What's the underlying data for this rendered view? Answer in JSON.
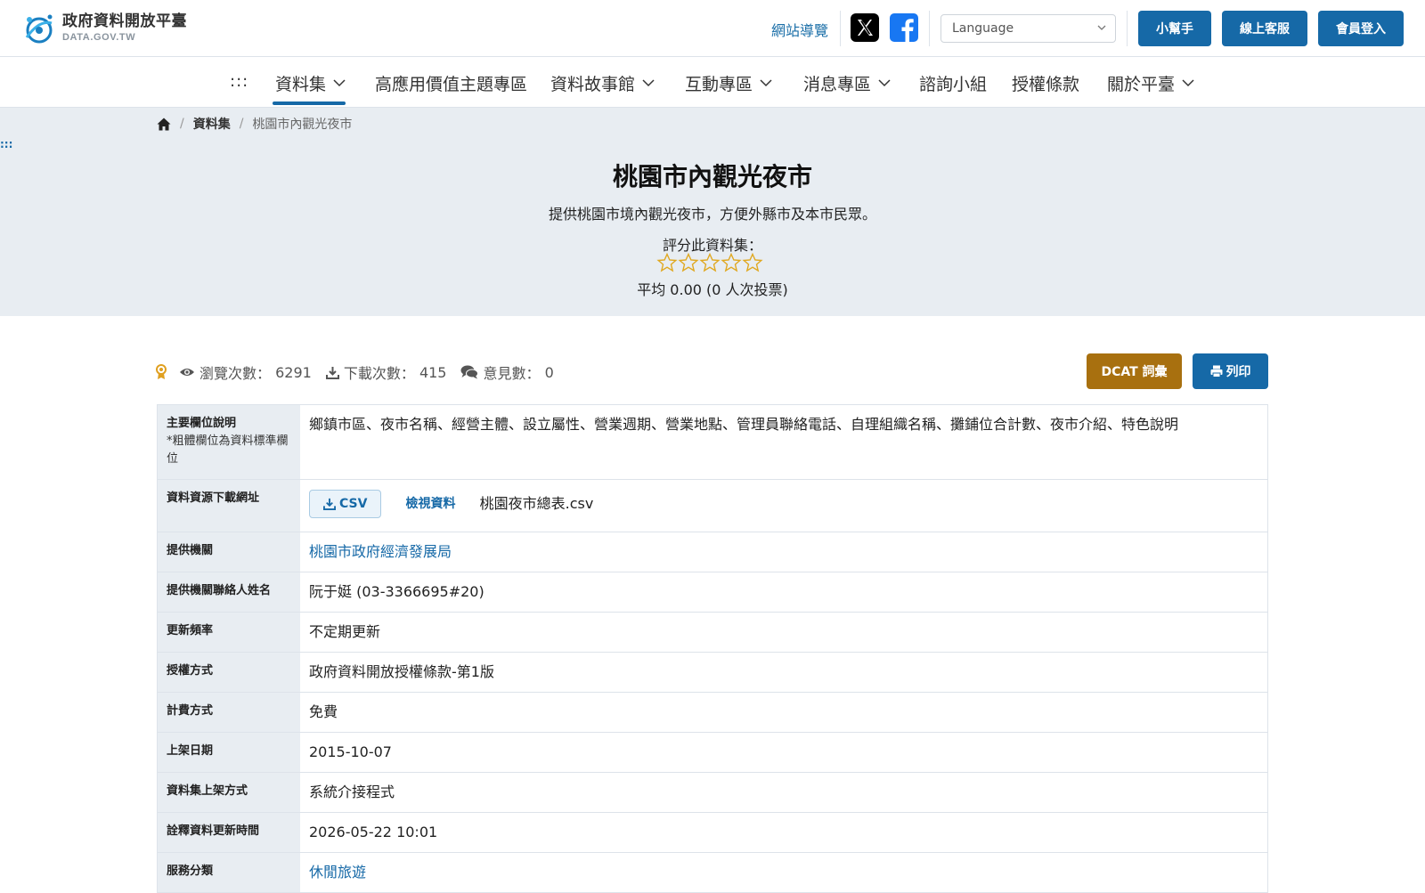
{
  "header": {
    "logo_title": "政府資料開放平臺",
    "logo_sub": "DATA.GOV.TW",
    "sitemap": "網站導覽",
    "language_placeholder": "Language",
    "buttons": {
      "helper": "小幫手",
      "support": "線上客服",
      "login": "會員登入"
    }
  },
  "nav": {
    "accesskey": ":::",
    "items": [
      {
        "label": "資料集",
        "dropdown": true,
        "active": true
      },
      {
        "label": "高應用價值主題專區",
        "dropdown": false
      },
      {
        "label": "資料故事館",
        "dropdown": true
      },
      {
        "label": "互動專區",
        "dropdown": true
      },
      {
        "label": "消息專區",
        "dropdown": true
      },
      {
        "label": "諮詢小組",
        "dropdown": false
      },
      {
        "label": "授權條款",
        "dropdown": false
      },
      {
        "label": "關於平臺",
        "dropdown": true
      }
    ]
  },
  "breadcrumb": {
    "home_icon": "home-icon",
    "section": "資料集",
    "current": "桃園市內觀光夜市"
  },
  "hero": {
    "accesskey": ":::",
    "title": "桃園市內觀光夜市",
    "description": "提供桃園市境內觀光夜市，方便外縣市及本市民眾。",
    "rating_label": "評分此資料集：",
    "stars": 0,
    "stars_max": 5,
    "rating_avg": "平均 0.00 (0 人次投票)"
  },
  "stats": {
    "views_label": "瀏覽次數：",
    "views": "6291",
    "downloads_label": "下載次數：",
    "downloads": "415",
    "comments_label": "意見數：",
    "comments": "0"
  },
  "actions": {
    "dcat": "DCAT 詞彙",
    "print": "列印"
  },
  "details": {
    "fields_label": "主要欄位說明",
    "fields_note": "*粗體欄位為資料標準欄位",
    "fields_value": "鄉鎮市區、夜市名稱、經營主體、設立屬性、營業週期、營業地點、管理員聯絡電話、自理組織名稱、攤鋪位合計數、夜市介紹、特色說明",
    "resource_label": "資料資源下載網址",
    "resource_format": "CSV",
    "resource_view": "檢視資料",
    "resource_file": "桃園夜市總表.csv",
    "provider_label": "提供機關",
    "provider_value": "桃園市政府經濟發展局",
    "contact_label": "提供機關聯絡人姓名",
    "contact_value": "阮于娗 (03-3366695#20)",
    "frequency_label": "更新頻率",
    "frequency_value": "不定期更新",
    "license_label": "授權方式",
    "license_value": "政府資料開放授權條款-第1版",
    "fee_label": "計費方式",
    "fee_value": "免費",
    "published_label": "上架日期",
    "published_value": "2015-10-07",
    "method_label": "資料集上架方式",
    "method_value": "系統介接程式",
    "meta_updated_label": "詮釋資料更新時間",
    "meta_updated_value": "2026-05-22 10:01",
    "category_label": "服務分類",
    "category_value": "休閒旅遊"
  }
}
